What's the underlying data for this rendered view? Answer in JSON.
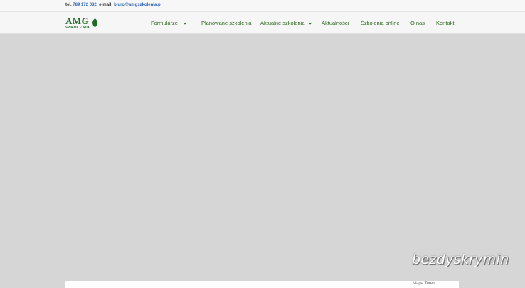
{
  "topbar": {
    "phone_label": "tel.",
    "phone": "789 172 032",
    "email_label": "e-mail:",
    "email": "biuro@amgszkolenia.pl"
  },
  "logo": {
    "main": "AMG",
    "sub": "SZKOLENIA",
    "icon": "leaf-icon"
  },
  "nav": {
    "items": [
      {
        "label": "Formularze",
        "has_dropdown": true
      },
      {
        "label": "Planowane szkolenia",
        "has_dropdown": false
      },
      {
        "label": "Aktualne szkolenia",
        "has_dropdown": true
      },
      {
        "label": "Aktualności",
        "has_dropdown": false
      },
      {
        "label": "Szkolenia online",
        "has_dropdown": false
      },
      {
        "label": "O nas",
        "has_dropdown": false
      },
      {
        "label": "Kontakt",
        "has_dropdown": false
      }
    ]
  },
  "panel": {
    "text": "Mapa   Teren"
  },
  "watermark": "bezdyskrymin",
  "colors": {
    "brand_green": "#1e6b26",
    "nav_text": "#2d6a1f",
    "link_blue": "#2b67b1",
    "hero_background": "#d6d6d6"
  }
}
